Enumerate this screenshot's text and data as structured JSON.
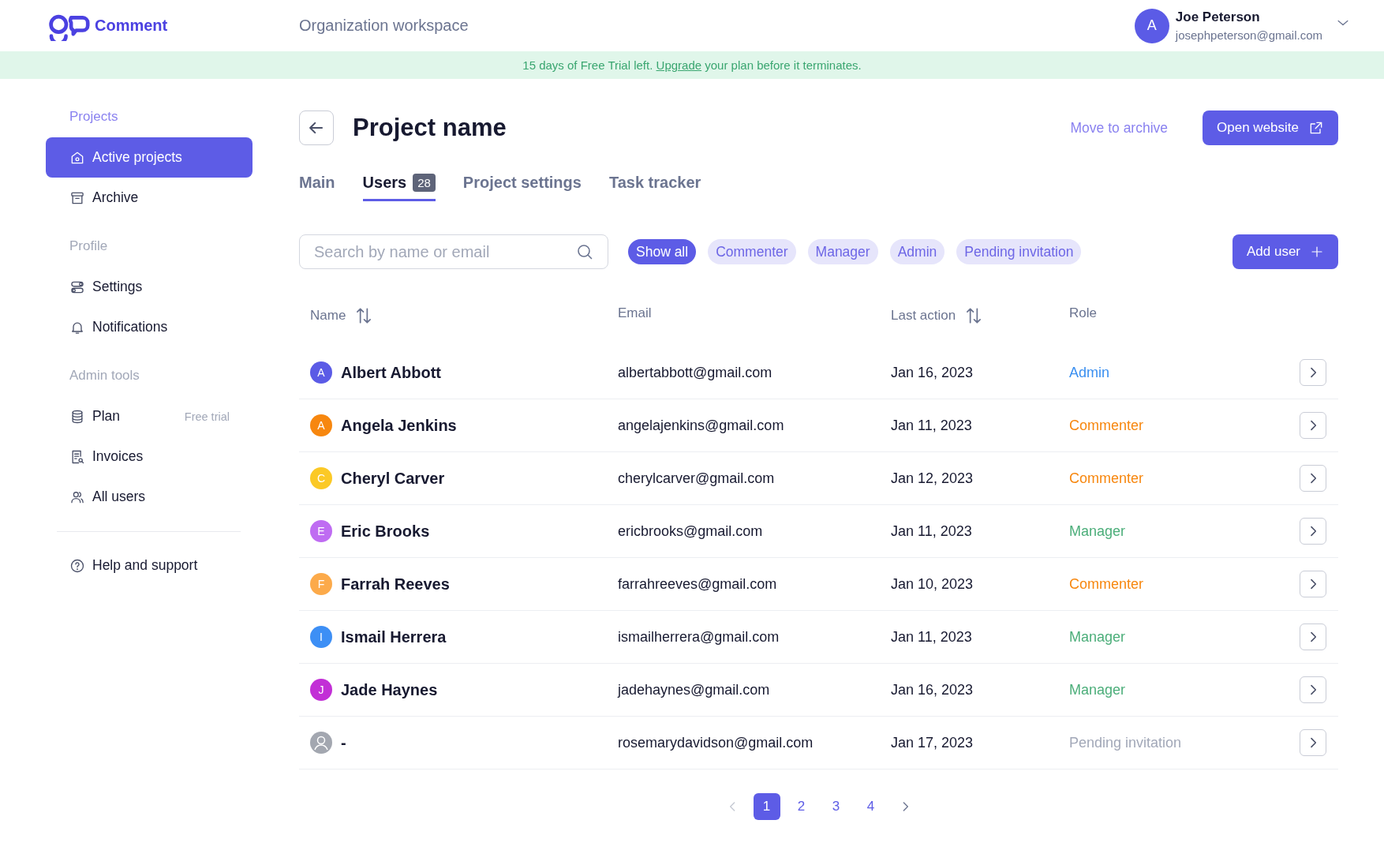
{
  "header": {
    "logo_text": "Comment",
    "workspace": "Organization workspace",
    "user": {
      "initial": "A",
      "name": "Joe Peterson",
      "email": "josephpeterson@gmail.com"
    }
  },
  "banner": {
    "before": "15 days of Free Trial left. ",
    "link": "Upgrade",
    "after": " your plan before it terminates."
  },
  "sidebar": {
    "sections": [
      {
        "heading": "Projects",
        "items": [
          {
            "label": "Active projects",
            "selected": true
          },
          {
            "label": "Archive",
            "selected": false
          }
        ]
      },
      {
        "heading": "Profile",
        "items": [
          {
            "label": "Settings",
            "selected": false
          },
          {
            "label": "Notifications",
            "selected": false
          }
        ]
      },
      {
        "heading": "Admin tools",
        "items": [
          {
            "label": "Plan",
            "selected": false,
            "note": "Free trial"
          },
          {
            "label": "Invoices",
            "selected": false
          },
          {
            "label": "All users",
            "selected": false
          }
        ]
      }
    ],
    "footer_item": {
      "label": "Help and support"
    }
  },
  "page": {
    "title": "Project name",
    "archive_link": "Move to archive",
    "open_button": "Open website"
  },
  "tabs": [
    {
      "label": "Main",
      "selected": false
    },
    {
      "label": "Users",
      "selected": true,
      "badge": "28"
    },
    {
      "label": "Project settings",
      "selected": false
    },
    {
      "label": "Task tracker",
      "selected": false
    }
  ],
  "search": {
    "placeholder": "Search by name or email"
  },
  "filters": [
    {
      "label": "Show all",
      "selected": true
    },
    {
      "label": "Commenter",
      "selected": false
    },
    {
      "label": "Manager",
      "selected": false
    },
    {
      "label": "Admin",
      "selected": false
    },
    {
      "label": "Pending invitation",
      "selected": false
    }
  ],
  "add_button": "Add user",
  "table": {
    "columns": [
      {
        "label": "Name",
        "sortable": true
      },
      {
        "label": "Email",
        "sortable": false
      },
      {
        "label": "Last action",
        "sortable": true
      },
      {
        "label": "Role",
        "sortable": false
      }
    ],
    "rows": [
      {
        "avatar": {
          "kind": "initial",
          "letter": "A",
          "color": "#5b5be6"
        },
        "name": "Albert Abbott",
        "email": "albertabbott@gmail.com",
        "last_action": "Jan 16, 2023",
        "role": {
          "kind": "admin",
          "label": "Admin"
        }
      },
      {
        "avatar": {
          "kind": "initial",
          "letter": "A",
          "color": "#f7870f"
        },
        "name": "Angela Jenkins",
        "email": "angelajenkins@gmail.com",
        "last_action": "Jan 11, 2023",
        "role": {
          "kind": "commenter",
          "label": "Commenter"
        }
      },
      {
        "avatar": {
          "kind": "initial",
          "letter": "C",
          "color": "#fbc926"
        },
        "name": "Cheryl Carver",
        "email": "cherylcarver@gmail.com",
        "last_action": "Jan 12, 2023",
        "role": {
          "kind": "commenter",
          "label": "Commenter"
        }
      },
      {
        "avatar": {
          "kind": "initial",
          "letter": "E",
          "color": "#bf6cf2"
        },
        "name": "Eric Brooks",
        "email": "ericbrooks@gmail.com",
        "last_action": "Jan 11, 2023",
        "role": {
          "kind": "manager",
          "label": "Manager"
        }
      },
      {
        "avatar": {
          "kind": "initial",
          "letter": "F",
          "color": "#fcaa4a"
        },
        "name": "Farrah Reeves",
        "email": "farrahreeves@gmail.com",
        "last_action": "Jan 10, 2023",
        "role": {
          "kind": "commenter",
          "label": "Commenter"
        }
      },
      {
        "avatar": {
          "kind": "initial",
          "letter": "I",
          "color": "#3d8ff5"
        },
        "name": "Ismail Herrera",
        "email": "ismailherrera@gmail.com",
        "last_action": "Jan 11, 2023",
        "role": {
          "kind": "manager",
          "label": "Manager"
        }
      },
      {
        "avatar": {
          "kind": "initial",
          "letter": "J",
          "color": "#c22fd6"
        },
        "name": "Jade Haynes",
        "email": "jadehaynes@gmail.com",
        "last_action": "Jan 16, 2023",
        "role": {
          "kind": "manager",
          "label": "Manager"
        }
      },
      {
        "avatar": {
          "kind": "person",
          "color": "#a3a7b0"
        },
        "name": "-",
        "email": "rosemarydavidson@gmail.com",
        "last_action": "Jan 17, 2023",
        "role": {
          "kind": "pending",
          "label": "Pending invitation"
        }
      }
    ]
  },
  "pagination": {
    "prev_disabled": true,
    "next_disabled": false,
    "pages": [
      {
        "label": "1",
        "selected": true
      },
      {
        "label": "2",
        "selected": false
      },
      {
        "label": "3",
        "selected": false
      },
      {
        "label": "4",
        "selected": false
      }
    ]
  }
}
